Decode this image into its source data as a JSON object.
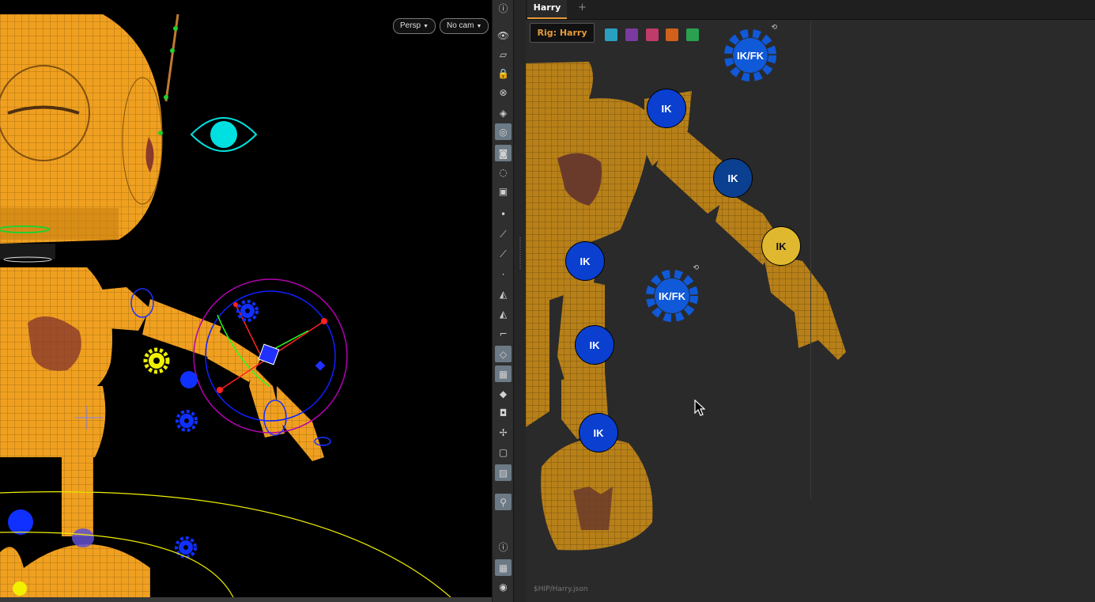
{
  "viewport": {
    "persp_label": "Persp",
    "cam_label": "No cam"
  },
  "picker": {
    "tab_label": "Harry",
    "add_tab": "+",
    "rig_label": "Rig: Harry",
    "swatches": [
      "#2aa0c0",
      "#7a3aa0",
      "#c03a6a",
      "#d0601a",
      "#2aa050"
    ],
    "controls": {
      "ikfk_top": "IK/FK",
      "ikfk_mid": "IK/FK",
      "shoulder_ik": "IK",
      "elbow_ik": "IK",
      "wrist_ik": "IK",
      "hip_ik": "IK",
      "knee_ik": "IK",
      "ankle_ik": "IK"
    },
    "footer_path": "$HIP/Harry.json"
  },
  "colors": {
    "accent": "#e79a3a",
    "ik_blue": "#0a3fd0",
    "ik_dark_blue": "#0b3f90",
    "ik_selected": "#e0b830",
    "gear_blue": "#1059d8",
    "robot_orange": "#f0a020"
  }
}
